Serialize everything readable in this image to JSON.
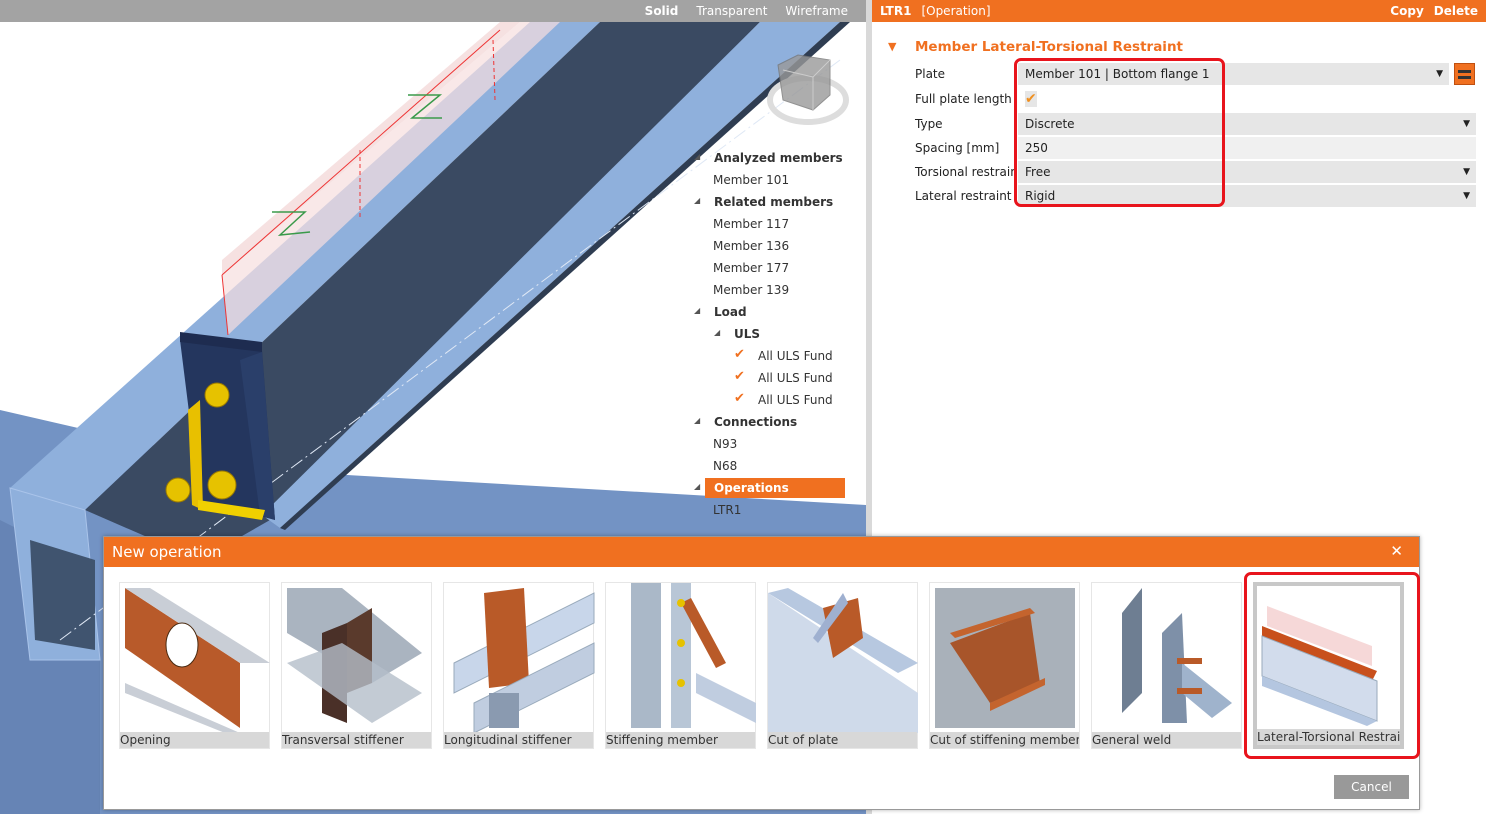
{
  "viewport": {
    "modes": [
      "Solid",
      "Transparent",
      "Wireframe"
    ],
    "active_mode": "Solid"
  },
  "tree": {
    "items": [
      {
        "label": "Analyzed members",
        "level": 0,
        "group": true
      },
      {
        "label": "Member 101",
        "level": 1
      },
      {
        "label": "Related members",
        "level": 0,
        "group": true
      },
      {
        "label": "Member 117",
        "level": 1
      },
      {
        "label": "Member 136",
        "level": 1
      },
      {
        "label": "Member 177",
        "level": 1
      },
      {
        "label": "Member 139",
        "level": 1
      },
      {
        "label": "Load",
        "level": 0,
        "group": true
      },
      {
        "label": "ULS",
        "level": 1,
        "group": true
      },
      {
        "label": "All ULS Fund",
        "level": 2,
        "checked": true
      },
      {
        "label": "All ULS Fund",
        "level": 2,
        "checked": true
      },
      {
        "label": "All ULS Fund",
        "level": 2,
        "checked": true
      },
      {
        "label": "Connections",
        "level": 0,
        "group": true
      },
      {
        "label": "N93",
        "level": 1
      },
      {
        "label": "N68",
        "level": 1
      },
      {
        "label": "Operations",
        "level": 0,
        "group": true,
        "selected": true
      },
      {
        "label": "LTR1",
        "level": 1
      }
    ]
  },
  "panel": {
    "name": "LTR1",
    "kind": "[Operation]",
    "copy": "Copy",
    "delete": "Delete",
    "section": "Member Lateral-Torsional Restraint",
    "props": [
      {
        "label": "Plate",
        "value": "Member 101 | Bottom flange 1",
        "dropdown": true
      },
      {
        "label": "Full plate length",
        "value": "checked",
        "checkbox": true
      },
      {
        "label": "Type",
        "value": "Discrete",
        "dropdown": true
      },
      {
        "label": "Spacing [mm]",
        "value": "250"
      },
      {
        "label": "Torsional restraint",
        "value": "Free",
        "dropdown": true
      },
      {
        "label": "Lateral restraint",
        "value": "Rigid",
        "dropdown": true
      }
    ]
  },
  "dialog": {
    "title": "New operation",
    "close": "✕",
    "tiles": [
      "Opening",
      "Transversal stiffener",
      "Longitudinal stiffener",
      "Stiffening member",
      "Cut of plate",
      "Cut of stiffening member",
      "General weld",
      "Lateral-Torsional Restraint"
    ],
    "selected": "Lateral-Torsional Restraint",
    "cancel": "Cancel"
  },
  "colors": {
    "accent": "#f07020",
    "highlight": "#e8141c",
    "steel": "#7c9fd0"
  }
}
